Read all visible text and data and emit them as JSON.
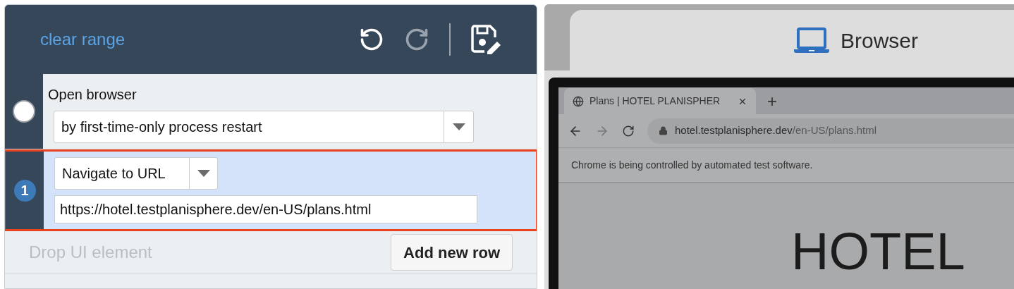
{
  "toolbar": {
    "clear_range": "clear range",
    "undo_enabled": true,
    "redo_enabled": false
  },
  "steps": [
    {
      "kind": "label-select",
      "selected": false,
      "label": "Open browser",
      "option": "by first-time-only process restart"
    },
    {
      "kind": "select-input",
      "selected": true,
      "number": "1",
      "option": "Navigate to URL",
      "value": "https://hotel.testplanisphere.dev/en-US/plans.html"
    }
  ],
  "footer": {
    "drop_hint": "Drop UI element",
    "add_button": "Add new row"
  },
  "browser": {
    "title": "Browser",
    "tab_title": "Plans | HOTEL PLANISPHER",
    "new_tab": "+",
    "url_host": "hotel.testplanisphere.dev",
    "url_path": "/en-US/plans.html",
    "infobar": "Chrome is being controlled by automated test software.",
    "heading": "HOTEL"
  }
}
